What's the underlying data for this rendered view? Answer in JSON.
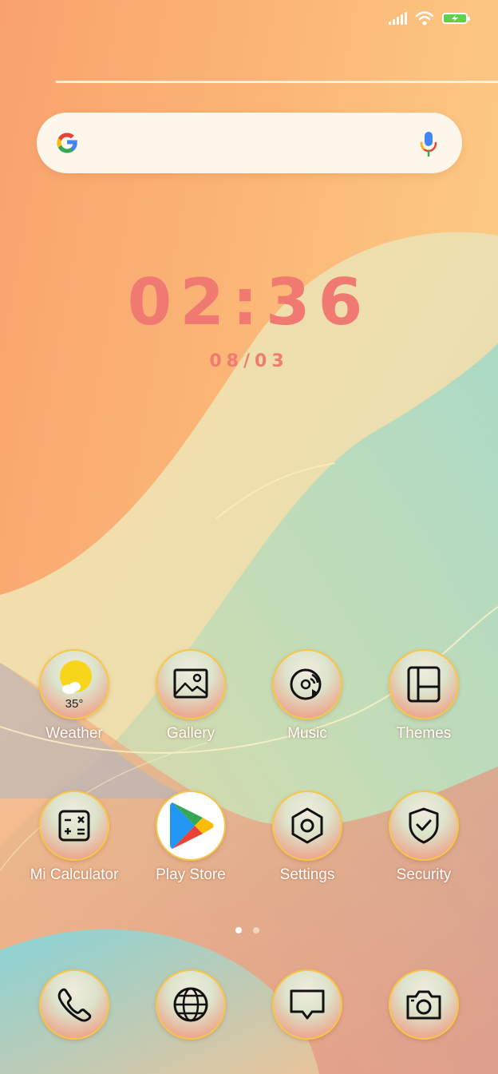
{
  "status_bar": {
    "signal_icon": "cellular-signal-icon",
    "wifi_icon": "wifi-icon",
    "battery_icon": "battery-charging-icon",
    "battery_color": "#5ed04a"
  },
  "search": {
    "logo": "google-logo",
    "mic_icon": "microphone-icon"
  },
  "clock": {
    "time": "02:36",
    "date": "08/03",
    "color": "#f07a72"
  },
  "apps": {
    "weather": {
      "label": "Weather",
      "temperature": "35°",
      "icon": "weather-sun-icon"
    },
    "gallery": {
      "label": "Gallery",
      "icon": "gallery-image-icon"
    },
    "music": {
      "label": "Music",
      "icon": "music-disc-icon"
    },
    "themes": {
      "label": "Themes",
      "icon": "themes-icon"
    },
    "calculator": {
      "label": "Mi Calculator",
      "icon": "calculator-icon"
    },
    "play_store": {
      "label": "Play Store",
      "icon": "play-store-icon"
    },
    "settings": {
      "label": "Settings",
      "icon": "settings-hexagon-icon"
    },
    "security": {
      "label": "Security",
      "icon": "shield-check-icon"
    }
  },
  "pager": {
    "pages": 2,
    "current": 1
  },
  "dock": [
    {
      "name": "phone",
      "icon": "phone-icon"
    },
    {
      "name": "browser",
      "icon": "globe-icon"
    },
    {
      "name": "messages",
      "icon": "message-icon"
    },
    {
      "name": "camera",
      "icon": "camera-icon"
    }
  ]
}
